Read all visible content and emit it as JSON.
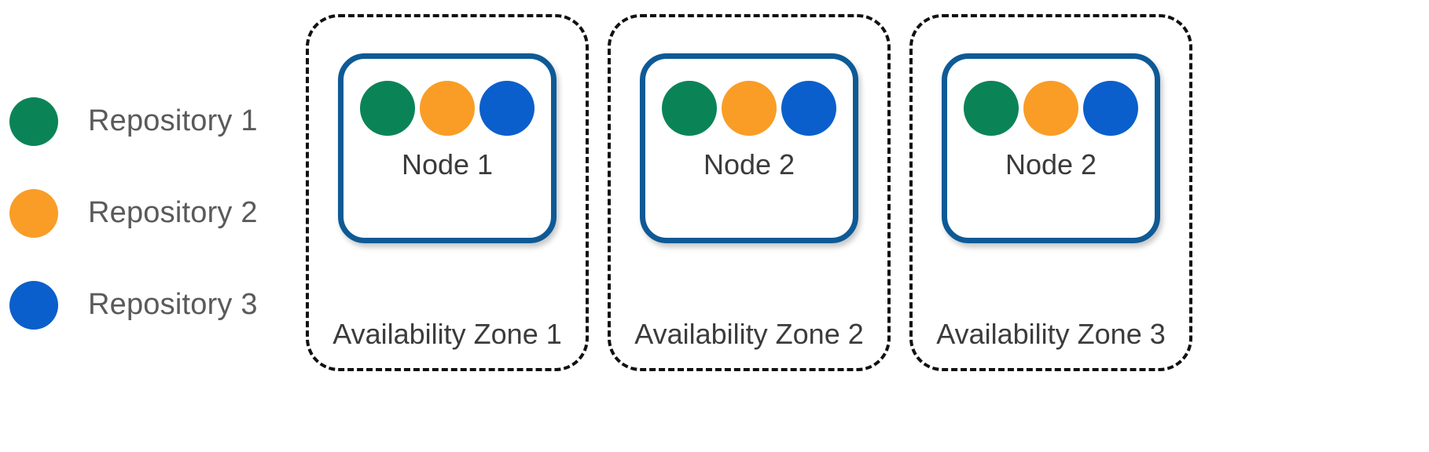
{
  "legend": {
    "items": [
      {
        "label": "Repository 1",
        "color": "#0a8457",
        "icon": "circle-icon"
      },
      {
        "label": "Repository 2",
        "color": "#f99d26",
        "icon": "circle-icon"
      },
      {
        "label": "Repository 3",
        "color": "#0b5fcc",
        "icon": "circle-icon"
      }
    ]
  },
  "colors": {
    "repository_1": "#0a8457",
    "repository_2": "#f99d26",
    "repository_3": "#0b5fcc",
    "node_border": "#0e5a96",
    "zone_border": "#111111",
    "legend_text": "#5a5a5c",
    "diagram_text": "#3b3b3d",
    "background": "#ffffff"
  },
  "zones": [
    {
      "label": "Availability Zone 1",
      "node": {
        "label": "Node 1",
        "repositories": [
          {
            "name": "Repository 1",
            "color": "#0a8457"
          },
          {
            "name": "Repository 2",
            "color": "#f99d26"
          },
          {
            "name": "Repository 3",
            "color": "#0b5fcc"
          }
        ]
      }
    },
    {
      "label": "Availability Zone 2",
      "node": {
        "label": "Node 2",
        "repositories": [
          {
            "name": "Repository 1",
            "color": "#0a8457"
          },
          {
            "name": "Repository 2",
            "color": "#f99d26"
          },
          {
            "name": "Repository 3",
            "color": "#0b5fcc"
          }
        ]
      }
    },
    {
      "label": "Availability Zone 3",
      "node": {
        "label": "Node 2",
        "repositories": [
          {
            "name": "Repository 1",
            "color": "#0a8457"
          },
          {
            "name": "Repository 2",
            "color": "#f99d26"
          },
          {
            "name": "Repository 3",
            "color": "#0b5fcc"
          }
        ]
      }
    }
  ]
}
